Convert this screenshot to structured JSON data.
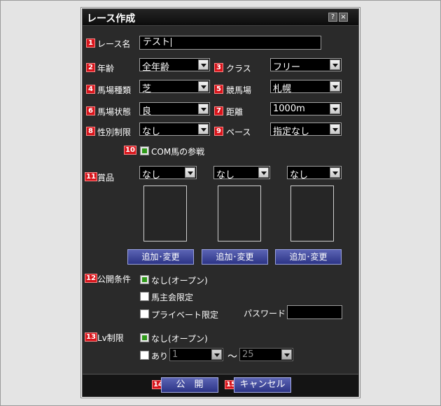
{
  "window": {
    "title": "レース作成",
    "help_label": "?",
    "close_label": "×"
  },
  "markers": [
    "1",
    "2",
    "3",
    "4",
    "5",
    "6",
    "7",
    "8",
    "9",
    "10",
    "11",
    "12",
    "13",
    "14",
    "15"
  ],
  "race_name": {
    "label": "レース名",
    "value": "テスト"
  },
  "age": {
    "label": "年齢",
    "value": "全年齢"
  },
  "class": {
    "label": "クラス",
    "value": "フリー"
  },
  "track_type": {
    "label": "馬場種類",
    "value": "芝"
  },
  "racecourse": {
    "label": "競馬場",
    "value": "札幌"
  },
  "track_condition": {
    "label": "馬場状態",
    "value": "良"
  },
  "distance": {
    "label": "距離",
    "value": "1000m"
  },
  "sex_limit": {
    "label": "性別制限",
    "value": "なし"
  },
  "pace": {
    "label": "ペース",
    "value": "指定なし"
  },
  "com_horses": {
    "label": "COM馬の参戦",
    "checked": true
  },
  "prize": {
    "label": "賞品",
    "slots": [
      {
        "value": "なし",
        "button": "追加･変更"
      },
      {
        "value": "なし",
        "button": "追加･変更"
      },
      {
        "value": "なし",
        "button": "追加･変更"
      }
    ]
  },
  "publish_conditions": {
    "label": "公開条件",
    "options": [
      {
        "label": "なし(オープン)",
        "checked": true
      },
      {
        "label": "馬主会限定",
        "checked": false
      },
      {
        "label": "プライベート限定",
        "checked": false
      }
    ],
    "password_label": "パスワード",
    "password_value": ""
  },
  "lv_limit": {
    "label": "Lv制限",
    "none_label": "なし(オープン)",
    "none_checked": true,
    "yes_label": "あり",
    "yes_checked": false,
    "min": "1",
    "range_sep": "～",
    "max": "25"
  },
  "footer": {
    "publish_label": "公　開",
    "cancel_label": "キャンセル"
  },
  "colors": {
    "marker": "#d8141b",
    "dialog_bg": "#2a2a2a",
    "button": "#3c44a0",
    "check_green": "#2f9a1a"
  }
}
